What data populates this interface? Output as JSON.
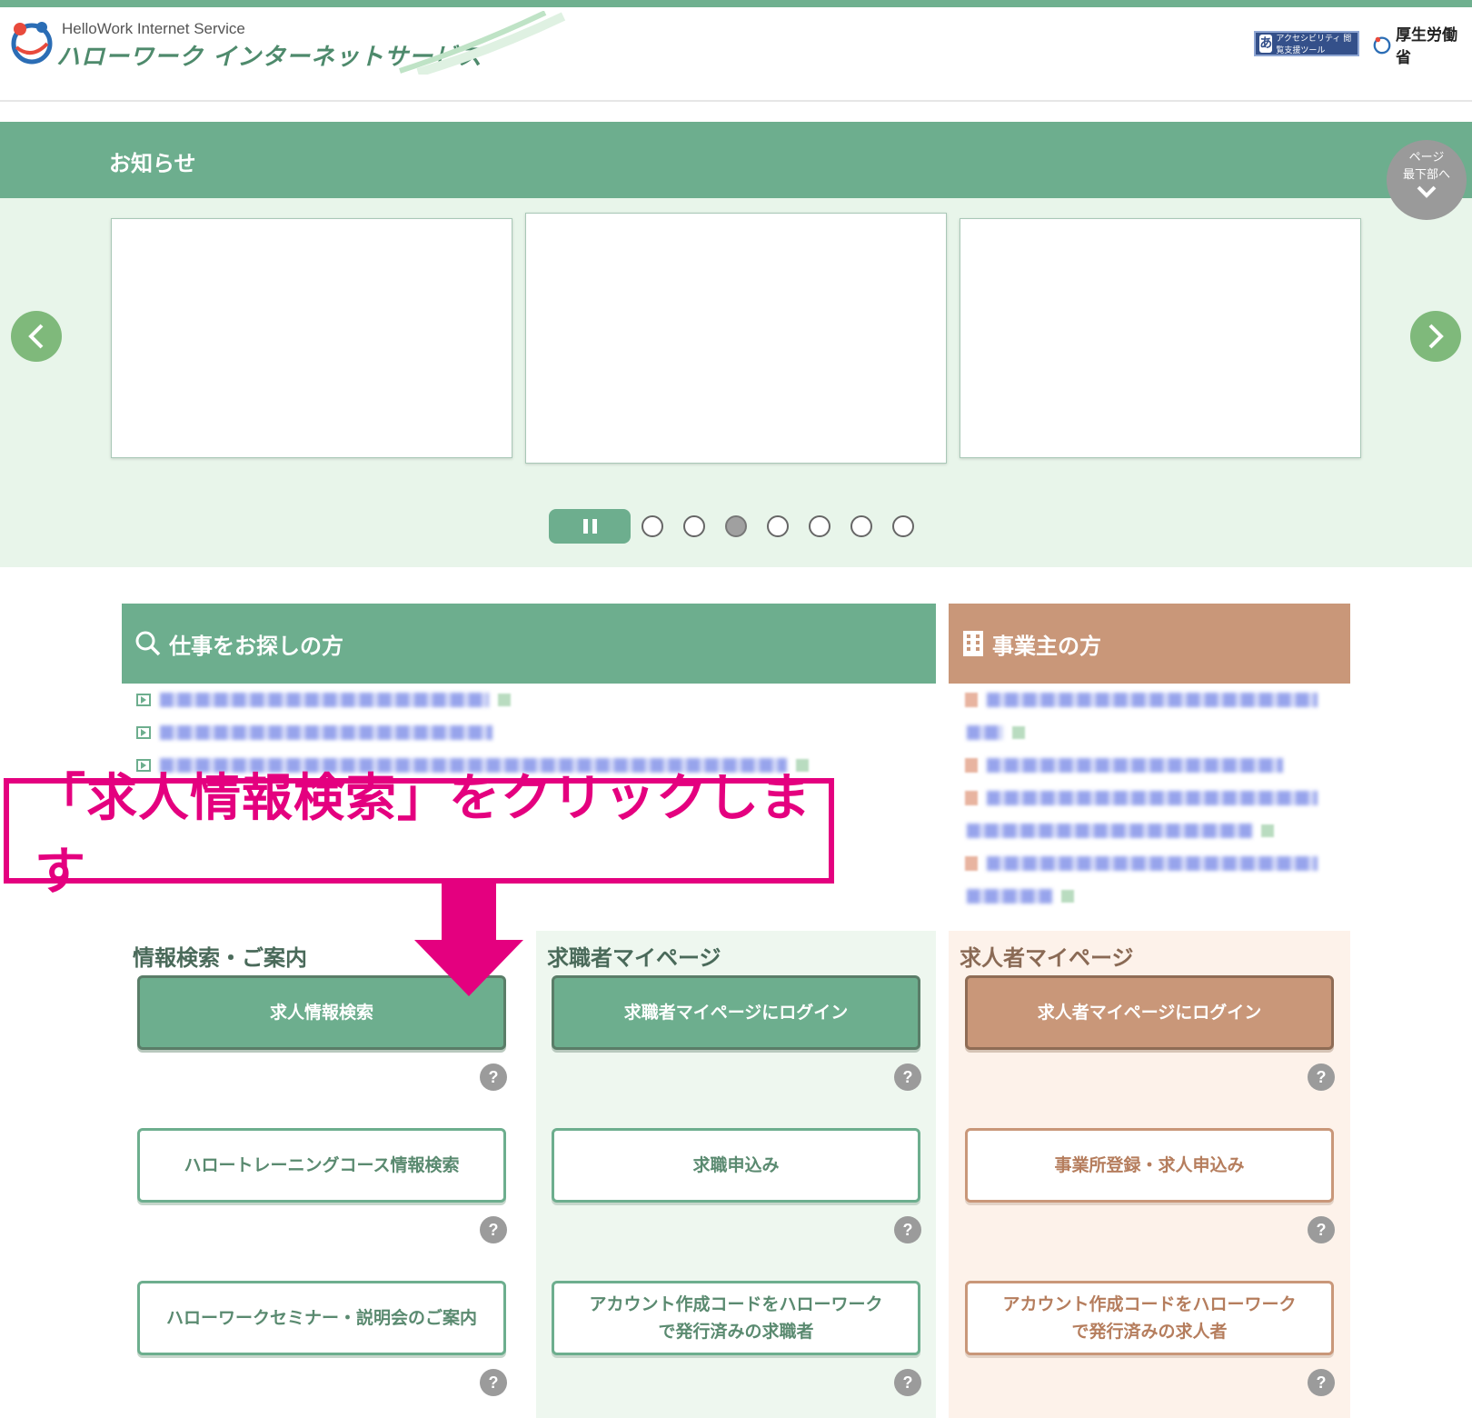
{
  "header": {
    "logo_en": "HelloWork Internet Service",
    "logo_ja": "ハローワーク インターネットサービス",
    "accessibility_label": "アクセシビリティ 閲覧支援ツール",
    "accessibility_icon": "あ",
    "ministry": "厚生労働省"
  },
  "notice": {
    "title": "お知らせ",
    "to_bottom_line1": "ページ",
    "to_bottom_line2": "最下部へ"
  },
  "carousel": {
    "dot_count": 7,
    "active_dot": 3
  },
  "seekers": {
    "title": "仕事をお探しの方"
  },
  "employers": {
    "title": "事業主の方"
  },
  "callout": {
    "text": "「求人情報検索」をクリックします"
  },
  "columns": {
    "info": {
      "title": "情報検索・ご案内",
      "buttons": [
        "求人情報検索",
        "ハロートレーニングコース情報検索",
        "ハローワークセミナー・説明会のご案内"
      ]
    },
    "seeker_mypage": {
      "title": "求職者マイページ",
      "buttons": [
        "求職者マイページにログイン",
        "求職申込み",
        "アカウント作成コードをハローワークで発行済みの求職者"
      ]
    },
    "employer_mypage": {
      "title": "求人者マイページ",
      "buttons": [
        "求人者マイページにログイン",
        "事業所登録・求人申込み",
        "アカウント作成コードをハローワークで発行済みの求人者"
      ]
    }
  },
  "help_symbol": "?",
  "colors": {
    "green": "#6dae8e",
    "brown": "#c99779",
    "callout": "#e4007f"
  }
}
